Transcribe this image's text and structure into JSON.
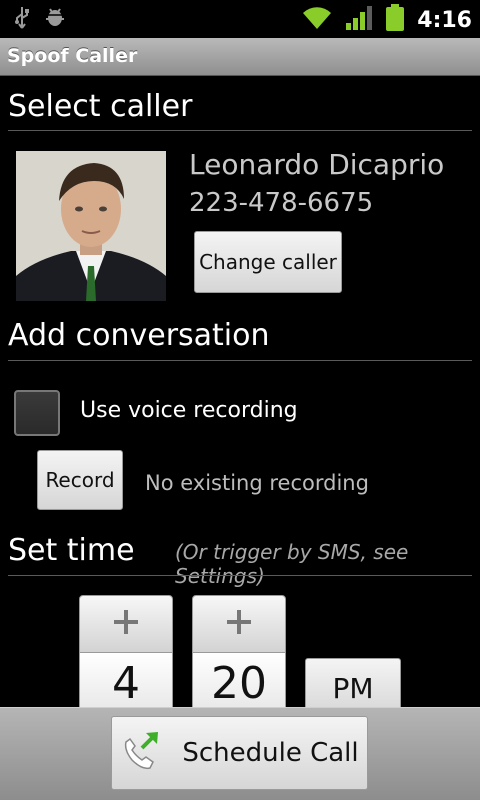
{
  "status_bar": {
    "time": "4:16",
    "icons": [
      "usb-icon",
      "android-debug-icon",
      "wifi-icon",
      "signal-icon",
      "battery-icon"
    ],
    "accent_color": "#8acd2a"
  },
  "app": {
    "title": "Spoof Caller"
  },
  "select_caller": {
    "heading": "Select caller",
    "name": "Leonardo Dicaprio",
    "phone": "223-478-6675",
    "change_label": "Change caller"
  },
  "conversation": {
    "heading": "Add conversation",
    "use_voice_label": "Use voice recording",
    "use_voice_checked": false,
    "record_label": "Record",
    "recording_status": "No existing recording"
  },
  "time": {
    "heading": "Set time",
    "hint": "(Or trigger by SMS, see Settings)",
    "plus_symbol": "+",
    "hour": "4",
    "minute": "20",
    "ampm": "PM"
  },
  "footer": {
    "schedule_label": "Schedule Call"
  }
}
